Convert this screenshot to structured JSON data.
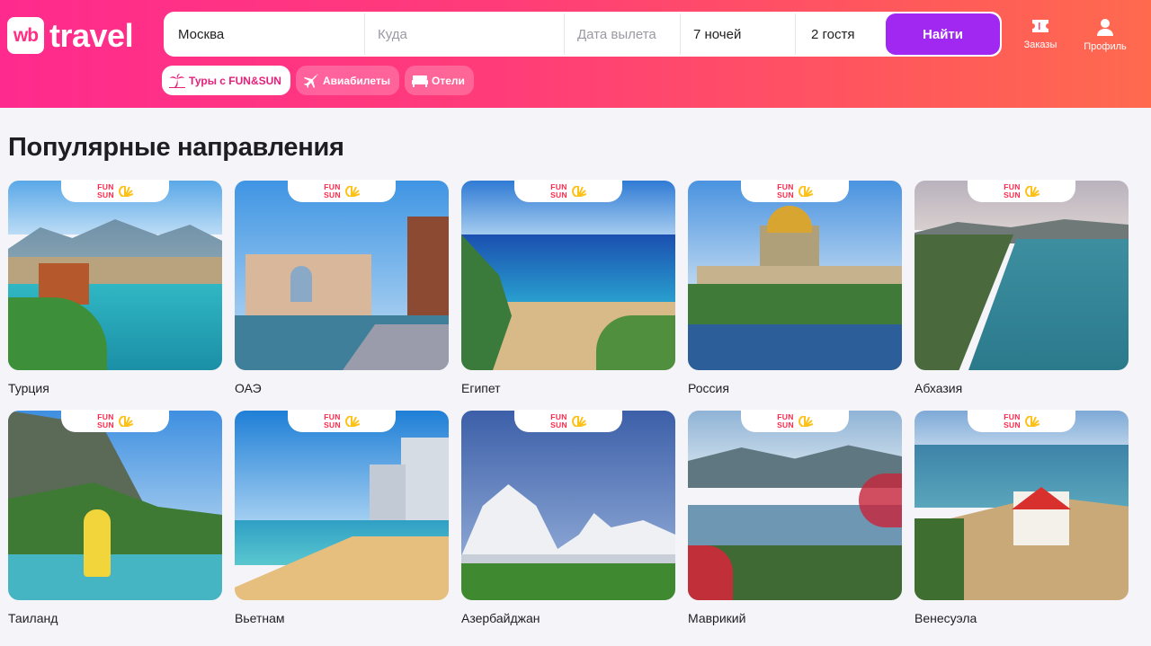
{
  "logo": {
    "mark": "wb",
    "text": "travel"
  },
  "search": {
    "from_value": "Москва",
    "to_placeholder": "Куда",
    "date_placeholder": "Дата вылета",
    "nights_value": "7 ночей",
    "guests_value": "2 гостя",
    "button_label": "Найти"
  },
  "header_icons": {
    "orders_label": "Заказы",
    "profile_label": "Профиль"
  },
  "tabs": [
    {
      "label": "Туры с FUN&SUN",
      "icon": "palm-icon",
      "active": true
    },
    {
      "label": "Авиабилеты",
      "icon": "plane-icon",
      "active": false
    },
    {
      "label": "Отели",
      "icon": "bed-icon",
      "active": false
    }
  ],
  "section": {
    "title": "Популярные направления"
  },
  "badge": {
    "line1": "FUN",
    "line2": "SUN"
  },
  "destinations": [
    {
      "name": "Турция"
    },
    {
      "name": "ОАЭ"
    },
    {
      "name": "Египет"
    },
    {
      "name": "Россия"
    },
    {
      "name": "Абхазия"
    },
    {
      "name": "Таиланд"
    },
    {
      "name": "Вьетнам"
    },
    {
      "name": "Азербайджан"
    },
    {
      "name": "Маврикий"
    },
    {
      "name": "Венесуэла"
    }
  ],
  "colors": {
    "brand_pink": "#ff2a8e",
    "brand_orange": "#ff6a4f",
    "button_purple": "#a028f0",
    "badge_red": "#ff2a4a",
    "badge_sun": "#ffc21a"
  }
}
